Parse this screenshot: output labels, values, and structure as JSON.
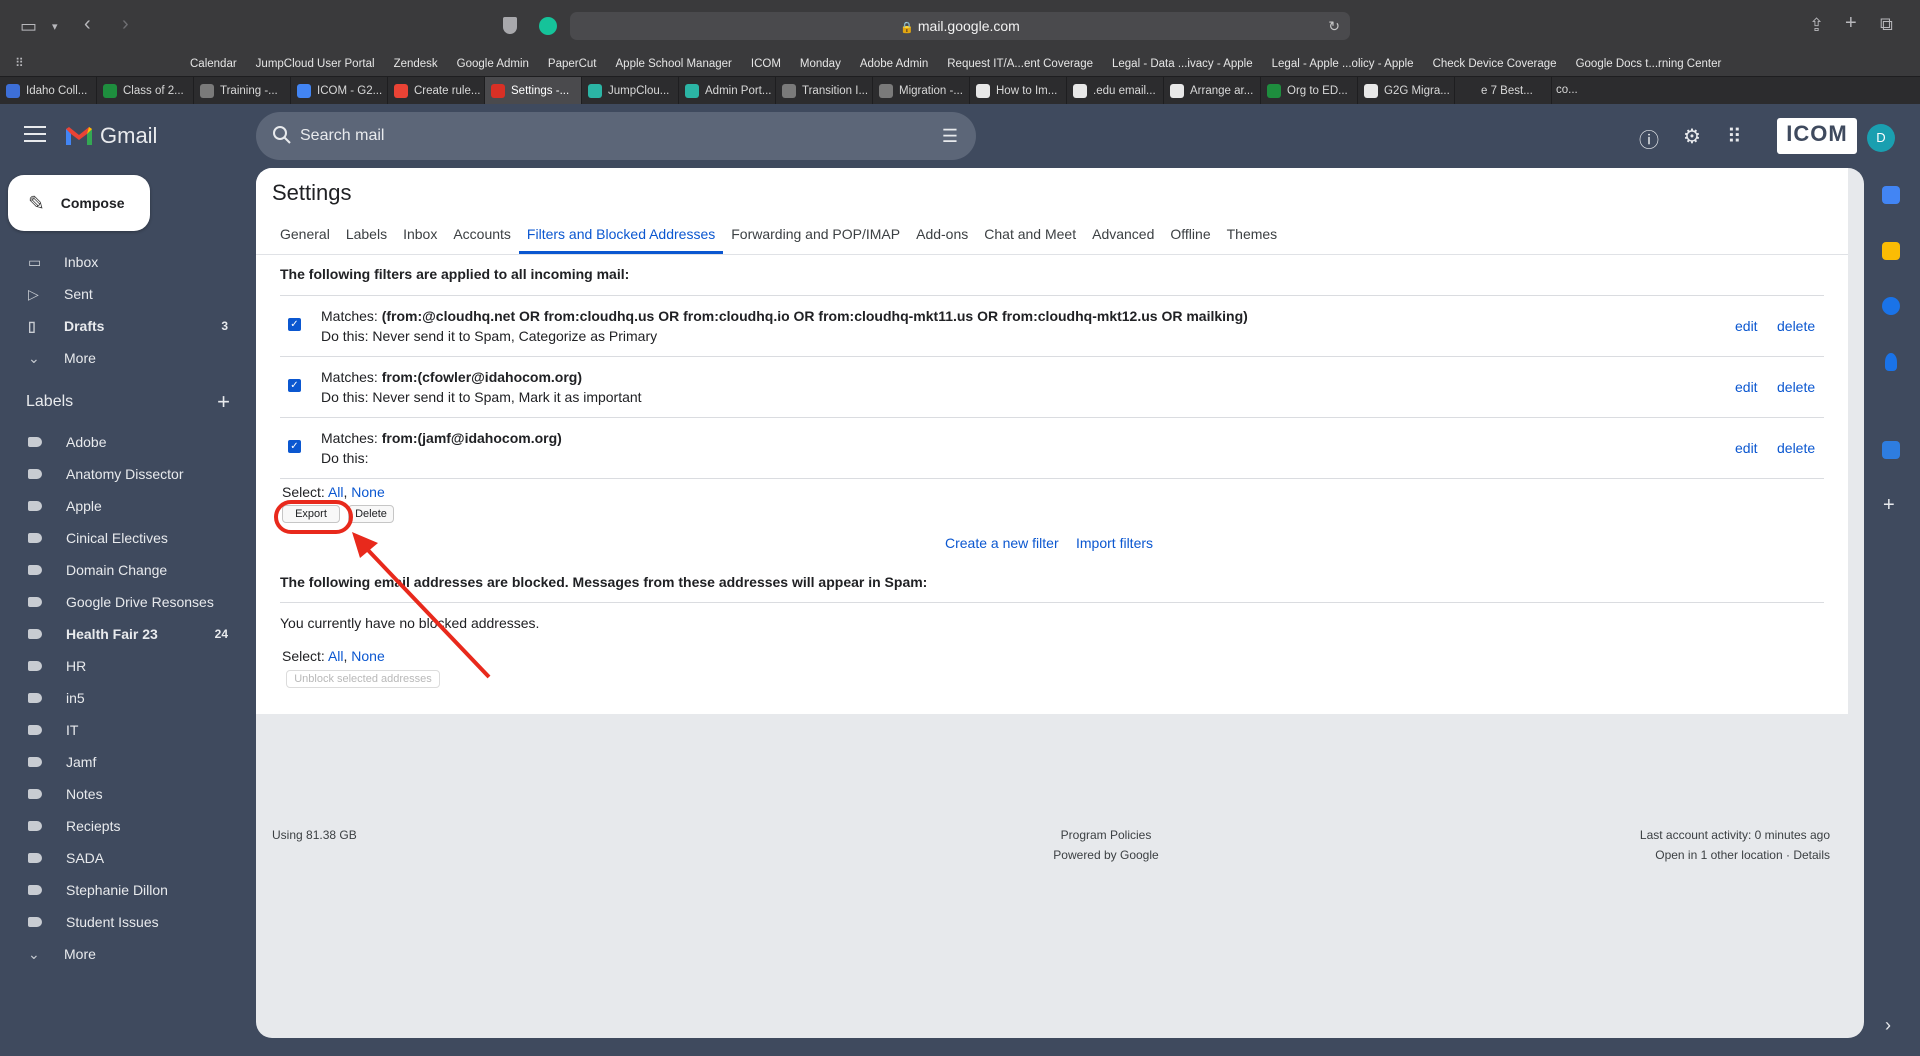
{
  "browser": {
    "url": "mail.google.com",
    "bookmarks": [
      "Calendar",
      "JumpCloud User Portal",
      "Zendesk",
      "Google Admin",
      "PaperCut",
      "Apple School Manager",
      "ICOM",
      "Monday",
      "Adobe Admin",
      "Request IT/A...ent Coverage",
      "Legal - Data ...ivacy - Apple",
      "Legal - Apple ...olicy - Apple",
      "Check Device Coverage",
      "Google Docs t...rning Center"
    ],
    "tabs": [
      {
        "label": "Idaho Coll...",
        "color": "#3d6fd8"
      },
      {
        "label": "Class of 2...",
        "color": "#1e8e3e"
      },
      {
        "label": "Training -...",
        "color": "#7a7a7a"
      },
      {
        "label": "ICOM - G2...",
        "color": "#4285f4"
      },
      {
        "label": "Create rule...",
        "color": "#ea4335"
      },
      {
        "label": "Settings -...",
        "color": "#d93025"
      },
      {
        "label": "JumpClou...",
        "color": "#2bb5a5"
      },
      {
        "label": "Admin Port...",
        "color": "#2bb5a5"
      },
      {
        "label": "Transition I...",
        "color": "#7a7a7a"
      },
      {
        "label": "Migration -...",
        "color": "#7a7a7a"
      },
      {
        "label": "How to Im...",
        "color": "#e8e8e8"
      },
      {
        "label": ".edu email...",
        "color": "#e8e8e8"
      },
      {
        "label": "Arrange ar...",
        "color": "#e8e8e8"
      },
      {
        "label": "Org to ED...",
        "color": "#1e8e3e"
      },
      {
        "label": "G2G Migra...",
        "color": "#e8e8e8"
      },
      {
        "label": "e 7 Best...",
        "color": "#2c2c2e"
      }
    ],
    "tab_overflow": "co..."
  },
  "gmail": {
    "product": "Gmail",
    "search_placeholder": "Search mail",
    "compose_label": "Compose",
    "org_logo": "ICOM",
    "avatar_letter": "D",
    "nav": [
      {
        "label": "Inbox",
        "icon": "inbox-icon",
        "count": ""
      },
      {
        "label": "Sent",
        "icon": "send-icon",
        "count": ""
      },
      {
        "label": "Drafts",
        "icon": "draft-icon",
        "count": "3"
      },
      {
        "label": "More",
        "icon": "chevron-down-icon",
        "count": ""
      }
    ],
    "labels_heading": "Labels",
    "labels": [
      {
        "label": "Adobe",
        "count": ""
      },
      {
        "label": "Anatomy Dissector",
        "count": ""
      },
      {
        "label": "Apple",
        "count": ""
      },
      {
        "label": "Cinical Electives",
        "count": ""
      },
      {
        "label": "Domain Change",
        "count": ""
      },
      {
        "label": "Google Drive Resonses",
        "count": ""
      },
      {
        "label": "Health Fair 23",
        "count": "24"
      },
      {
        "label": "HR",
        "count": ""
      },
      {
        "label": "in5",
        "count": ""
      },
      {
        "label": "IT",
        "count": ""
      },
      {
        "label": "Jamf",
        "count": ""
      },
      {
        "label": "Notes",
        "count": ""
      },
      {
        "label": "Reciepts",
        "count": ""
      },
      {
        "label": "SADA",
        "count": ""
      },
      {
        "label": "Stephanie Dillon",
        "count": ""
      },
      {
        "label": "Student Issues",
        "count": ""
      }
    ],
    "labels_more": "More"
  },
  "settings": {
    "title": "Settings",
    "tabs": [
      "General",
      "Labels",
      "Inbox",
      "Accounts",
      "Filters and Blocked Addresses",
      "Forwarding and POP/IMAP",
      "Add-ons",
      "Chat and Meet",
      "Advanced",
      "Offline",
      "Themes"
    ],
    "selected_tab": "Filters and Blocked Addresses",
    "filters_heading": "The following filters are applied to all incoming mail:",
    "filters": [
      {
        "matches_label": "Matches:",
        "criteria": "(from:@cloudhq.net OR from:cloudhq.us OR from:cloudhq.io OR from:cloudhq-mkt11.us OR from:cloudhq-mkt12.us OR mailking)",
        "action": "Do this: Never send it to Spam, Categorize as Primary",
        "checked": true
      },
      {
        "matches_label": "Matches:",
        "criteria": "from:(cfowler@idahocom.org)",
        "action": "Do this: Never send it to Spam, Mark it as important",
        "checked": true
      },
      {
        "matches_label": "Matches:",
        "criteria": "from:(jamf@idahocom.org)",
        "action": "Do this:",
        "checked": true
      }
    ],
    "edit_label": "edit",
    "delete_label": "delete",
    "select_label": "Select:",
    "select_all": "All",
    "select_none": "None",
    "export_button": "Export",
    "delete_button": "Delete",
    "create_filter": "Create a new filter",
    "import_filters": "Import filters",
    "blocked_heading": "The following email addresses are blocked. Messages from these addresses will appear in Spam:",
    "no_blocked": "You currently have no blocked addresses.",
    "unblock_button": "Unblock selected addresses"
  },
  "footer": {
    "storage": "Using 81.38 GB",
    "program_policies": "Program Policies",
    "powered_by": "Powered by Google",
    "last_activity": "Last account activity: 0 minutes ago",
    "open_other": "Open in 1 other location · Details"
  },
  "colors": {
    "accent": "#0b57d0",
    "annotation": "#e8291c",
    "sidebar_bg": "#3f4a5e"
  }
}
